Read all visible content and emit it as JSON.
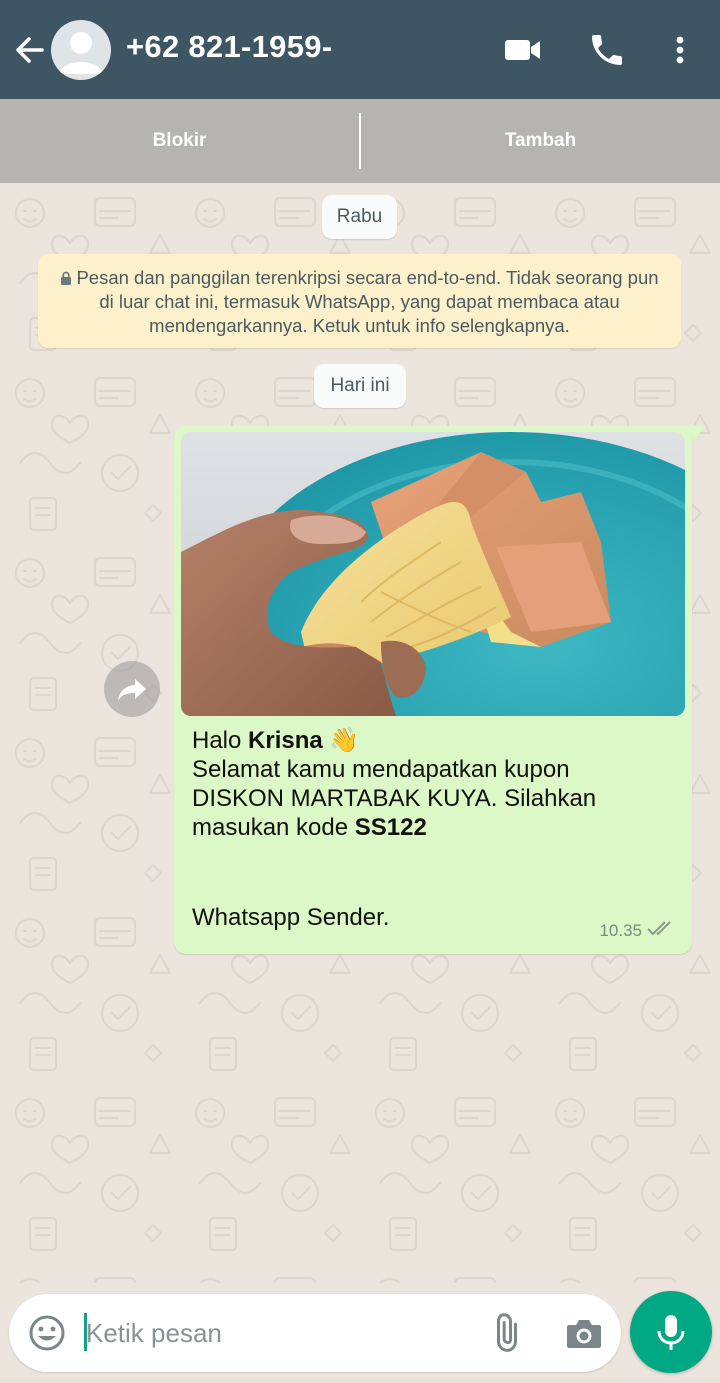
{
  "header": {
    "contact_name": "+62 821-1959-",
    "icons": [
      "arrow-left-icon",
      "avatar-placeholder",
      "video-call-icon",
      "phone-call-icon",
      "more-vert-icon"
    ],
    "bg_color": "#3e5563"
  },
  "actions": {
    "block_label": "Blokir",
    "add_label": "Tambah"
  },
  "chat": {
    "date_1": "Rabu",
    "encryption_notice": "Pesan dan panggilan terenkripsi secara end-to-end. Tidak seorang pun di luar chat ini, termasuk WhatsApp, yang dapat membaca atau mendengarkannya. Ketuk untuk info selengkapnya.",
    "date_2": "Hari ini",
    "message": {
      "greeting": "Halo",
      "name": "Krisna",
      "emoji": "👋",
      "line_1": "Selamat kamu mendapatkan kupon",
      "line_2": "DISKON MARTABAK KUYA. Silahkan",
      "line_3_prefix": "masukan kode",
      "code": "SS122",
      "signature": "Whatsapp Sender.",
      "time": "10.35",
      "status": "delivered",
      "bubble_color": "#dcf8c6"
    }
  },
  "input": {
    "placeholder": "Ketik pesan",
    "accent_color": "#00a884"
  }
}
